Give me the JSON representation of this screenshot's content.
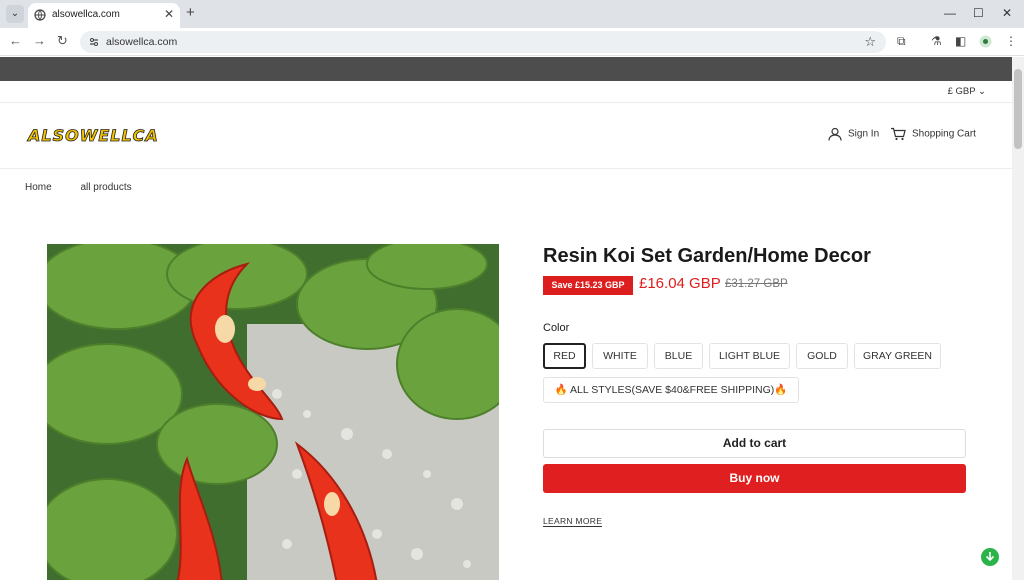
{
  "browser": {
    "tab_title": "alsowellca.com",
    "url": "alsowellca.com",
    "new_tab_symbol": "+",
    "icons": [
      "tab-search-icon",
      "globe-icon",
      "close-icon",
      "back-icon",
      "forward-icon",
      "reload-icon",
      "site-settings-icon",
      "star-icon",
      "extensions-icon",
      "lab-icon",
      "sidepanel-icon",
      "profile-icon",
      "menu-icon",
      "minimize-icon",
      "maximize-icon",
      "window-close-icon"
    ]
  },
  "store": {
    "currency": "£ GBP",
    "logo_text": "ALSOWELLCA",
    "sign_in": "Sign In",
    "cart": "Shopping Cart"
  },
  "breadcrumb": [
    "Home",
    "all products"
  ],
  "product": {
    "title": "Resin Koi Set Garden/Home Decor",
    "save_badge": "Save £15.23 GBP",
    "price": "£16.04 GBP",
    "compare_price": "£31.27 GBP",
    "color_label": "Color",
    "colors": [
      "RED",
      "WHITE",
      "BLUE",
      "LIGHT BLUE",
      "GOLD",
      "GRAY GREEN"
    ],
    "selected_color": "RED",
    "bundle_option": "🔥 ALL STYLES(SAVE $40&FREE SHIPPING)🔥",
    "add_to_cart": "Add to cart",
    "buy_now": "Buy now",
    "learn_more": "LEARN MORE"
  },
  "colors": {
    "accent": "#e02020",
    "badge": "#dd1e1e",
    "announcement_bar": "#4d4d4d"
  }
}
